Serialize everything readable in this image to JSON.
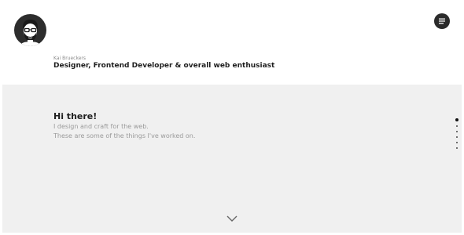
{
  "header": {
    "avatar_icon": "bearded-man-with-glasses-avatar-icon",
    "menu_icon": "hamburger-menu-icon",
    "byline": "Kai Brueckers",
    "tagline": "Designer, Frontend Developer & overall web enthusiast"
  },
  "hero": {
    "title": "Hi there!",
    "lines": [
      "I design and craft for the web.",
      "These are some of the things I've worked on."
    ],
    "scroll_icon": "chevron-down-icon"
  },
  "section_nav": {
    "count": 6,
    "active_index": 0
  },
  "colors": {
    "hero_background": "#f0f0f0",
    "text_dark": "#1e1e1e",
    "text_muted": "#9a9a9a",
    "avatar_background": "#2d2d2d"
  }
}
